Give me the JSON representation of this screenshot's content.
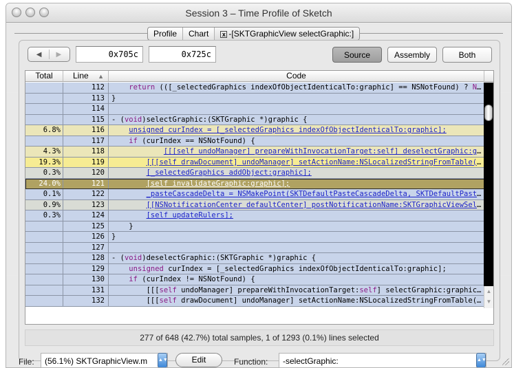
{
  "window": {
    "title": "Session 3 – Time Profile of Sketch"
  },
  "tabs": [
    {
      "label": "Profile"
    },
    {
      "label": "Chart"
    },
    {
      "label": "-[SKTGraphicView selectGraphic:]",
      "closable": true
    }
  ],
  "toolbar": {
    "address_start": "0x705c",
    "address_end": "0x725c",
    "source_label": "Source",
    "assembly_label": "Assembly",
    "both_label": "Both",
    "selected_view": "Source"
  },
  "table": {
    "columns": [
      "Total",
      "Line",
      "Code"
    ],
    "sorted_column": "Line",
    "rows": [
      {
        "total": "",
        "line": "112",
        "style": "c-blue",
        "code": [
          {
            "t": "    "
          },
          {
            "t": "return",
            "k": "kw"
          },
          {
            "t": " (([_selectedGraphics indexOfObjectIdenticalTo:graphic] == NSNotFound) ? "
          },
          {
            "t": "NO",
            "k": "kw"
          },
          {
            "t": "…"
          }
        ]
      },
      {
        "total": "",
        "line": "113",
        "style": "c-blue",
        "code": [
          {
            "t": "}"
          }
        ]
      },
      {
        "total": "",
        "line": "114",
        "style": "c-blue",
        "code": [
          {
            "t": ""
          }
        ]
      },
      {
        "total": "",
        "line": "115",
        "style": "c-blue",
        "code": [
          {
            "t": "- ("
          },
          {
            "t": "void",
            "k": "kw"
          },
          {
            "t": ")selectGraphic:(SKTGraphic *)graphic {"
          }
        ]
      },
      {
        "total": "6.8%",
        "line": "116",
        "style": "c-tan",
        "code": [
          {
            "t": "    "
          },
          {
            "t": "unsigned curIndex = [_selectedGraphics indexOfObjectIdenticalTo:graphic];",
            "k": "link"
          }
        ]
      },
      {
        "total": "",
        "line": "117",
        "style": "c-blue",
        "code": [
          {
            "t": "    "
          },
          {
            "t": "if",
            "k": "kw"
          },
          {
            "t": " (curIndex == NSNotFound) {"
          }
        ]
      },
      {
        "total": "4.3%",
        "line": "118",
        "style": "c-tan",
        "code": [
          {
            "t": "            "
          },
          {
            "t": "[[[self undoManager] prepareWithInvocationTarget:self] deselectGraphic:graphic];",
            "k": "link"
          }
        ]
      },
      {
        "total": "19.3%",
        "line": "119",
        "style": "c-yellow",
        "code": [
          {
            "t": "        "
          },
          {
            "t": "[[[self drawDocument] undoManager] setActionName:NSLocalizedStringFromTable(@…",
            "k": "link"
          }
        ]
      },
      {
        "total": "0.3%",
        "line": "120",
        "style": "c-gray",
        "code": [
          {
            "t": "        "
          },
          {
            "t": "[_selectedGraphics addObject:graphic];",
            "k": "link"
          }
        ]
      },
      {
        "total": "24.0%",
        "line": "121",
        "style": "c-sel",
        "code": [
          {
            "t": "        "
          },
          {
            "t": "[self invalidateGraphic:graphic];",
            "k": "link"
          }
        ]
      },
      {
        "total": "0.1%",
        "line": "122",
        "style": "c-blue",
        "code": [
          {
            "t": "        "
          },
          {
            "t": "_pasteCascadeDelta = NSMakePoint(SKTDefaultPasteCascadeDelta, SKTDefaultPaste…",
            "k": "link"
          }
        ]
      },
      {
        "total": "0.9%",
        "line": "123",
        "style": "c-gray",
        "code": [
          {
            "t": "        "
          },
          {
            "t": "[[NSNotificationCenter defaultCenter] postNotificationName:SKTGraphicViewSele…",
            "k": "link"
          }
        ]
      },
      {
        "total": "0.3%",
        "line": "124",
        "style": "c-blue",
        "code": [
          {
            "t": "        "
          },
          {
            "t": "[self updateRulers];",
            "k": "link"
          }
        ]
      },
      {
        "total": "",
        "line": "125",
        "style": "c-blue",
        "code": [
          {
            "t": "    }"
          }
        ]
      },
      {
        "total": "",
        "line": "126",
        "style": "c-blue",
        "code": [
          {
            "t": "}"
          }
        ]
      },
      {
        "total": "",
        "line": "127",
        "style": "c-blue",
        "code": [
          {
            "t": ""
          }
        ]
      },
      {
        "total": "",
        "line": "128",
        "style": "c-blue",
        "code": [
          {
            "t": "- ("
          },
          {
            "t": "void",
            "k": "kw"
          },
          {
            "t": ")deselectGraphic:(SKTGraphic *)graphic {"
          }
        ]
      },
      {
        "total": "",
        "line": "129",
        "style": "c-blue",
        "code": [
          {
            "t": "    "
          },
          {
            "t": "unsigned",
            "k": "kw"
          },
          {
            "t": " curIndex = [_selectedGraphics indexOfObjectIdenticalTo:graphic];"
          }
        ]
      },
      {
        "total": "",
        "line": "130",
        "style": "c-blue",
        "code": [
          {
            "t": "    "
          },
          {
            "t": "if",
            "k": "kw"
          },
          {
            "t": " (curIndex != NSNotFound) {"
          }
        ]
      },
      {
        "total": "",
        "line": "131",
        "style": "c-blue",
        "code": [
          {
            "t": "        [[["
          },
          {
            "t": "self",
            "k": "kw"
          },
          {
            "t": " undoManager] prepareWithInvocationTarget:"
          },
          {
            "t": "self",
            "k": "kw"
          },
          {
            "t": "] selectGraphic:graphic];"
          }
        ]
      },
      {
        "total": "",
        "line": "132",
        "style": "c-blue",
        "code": [
          {
            "t": "        [[["
          },
          {
            "t": "self",
            "k": "kw"
          },
          {
            "t": " drawDocument] undoManager] setActionName:NSLocalizedStringFromTable("
          },
          {
            "t": "@",
            "k": "str"
          },
          {
            "t": "…"
          }
        ]
      }
    ]
  },
  "status": {
    "text": "277 of 648 (42.7%) total samples, 1 of 1293 (0.1%) lines selected"
  },
  "bottom": {
    "file_label": "File:",
    "file_value": "(56.1%) SKTGraphicView.m",
    "edit_label": "Edit",
    "function_label": "Function:",
    "function_value": "-selectGraphic:"
  },
  "icons": {
    "back": "◀",
    "forward": "▶",
    "sort_ascending": "▲",
    "popup_arrows": "▲▼",
    "scroll_up": "▲",
    "scroll_down": "▼",
    "tab_close": "x"
  }
}
